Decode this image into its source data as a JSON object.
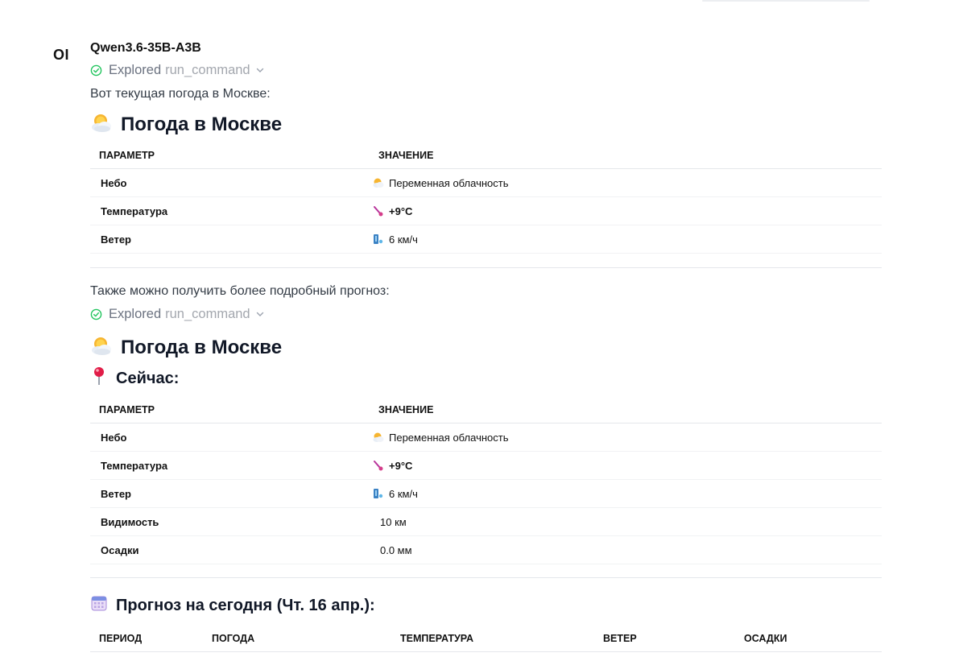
{
  "message": {
    "avatar_text": "OI",
    "model_name": "Qwen3.6-35B-A3B",
    "explored_1": {
      "label": "Explored",
      "tool": "run_command"
    },
    "intro_1": "Вот текущая погода в Москве:",
    "heading_1": "Погода в Москве",
    "table_1": {
      "headers": [
        "ПАРАМЕТР",
        "ЗНАЧЕНИЕ"
      ],
      "rows": [
        {
          "param": "Небо",
          "value": "Переменная облачность",
          "icon": "sun-behind-cloud-icon"
        },
        {
          "param": "Температура",
          "value": "+9°C",
          "icon": "thermometer-icon"
        },
        {
          "param": "Ветер",
          "value": "6 км/ч",
          "icon": "wind-icon"
        }
      ]
    },
    "intro_2": "Также можно получить более подробный прогноз:",
    "explored_2": {
      "label": "Explored",
      "tool": "run_command"
    },
    "heading_2": "Погода в Москве",
    "subheading_now": "Сейчас:",
    "table_2": {
      "headers": [
        "ПАРАМЕТР",
        "ЗНАЧЕНИЕ"
      ],
      "rows": [
        {
          "param": "Небо",
          "value": "Переменная облачность",
          "icon": "sun-behind-cloud-icon"
        },
        {
          "param": "Температура",
          "value": "+9°C",
          "icon": "thermometer-icon"
        },
        {
          "param": "Ветер",
          "value": "6 км/ч",
          "icon": "wind-icon"
        },
        {
          "param": "Видимость",
          "value": "10 км",
          "icon": ""
        },
        {
          "param": "Осадки",
          "value": "0.0 мм",
          "icon": ""
        }
      ]
    },
    "subheading_forecast": "Прогноз на сегодня (Чт. 16 апр.):",
    "table_3": {
      "headers": [
        "ПЕРИОД",
        "ПОГОДА",
        "ТЕМПЕРАТУРА",
        "ВЕТЕР",
        "ОСАДКИ"
      ]
    }
  },
  "colors": {
    "check": "#22c55e",
    "accent_pin": "#e11d48"
  }
}
